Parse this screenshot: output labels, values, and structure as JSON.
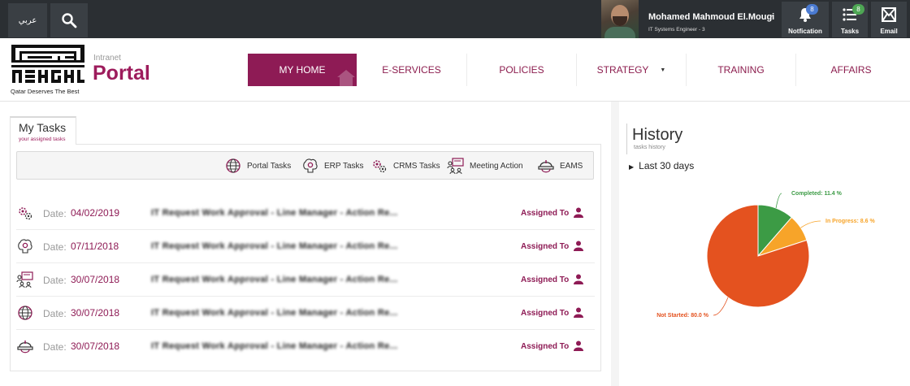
{
  "topbar": {
    "language_label": "عربي",
    "user": {
      "name": "Mohamed Mahmoud El.Mougi",
      "role": "IT Systems Engineer - 3"
    },
    "notification": {
      "label": "Notfication",
      "count": "8"
    },
    "tasks": {
      "label": "Tasks",
      "count": "8"
    },
    "email": {
      "label": "Email"
    }
  },
  "header": {
    "tagline": "Qatar Deserves The Best",
    "intranet": "Intranet",
    "portal": "Portal",
    "nav": [
      {
        "label": "MY HOME"
      },
      {
        "label": "E-SERVICES"
      },
      {
        "label": "POLICIES"
      },
      {
        "label": "STRATEGY"
      },
      {
        "label": "TRAINING"
      },
      {
        "label": "AFFAIRS"
      }
    ]
  },
  "tasks_panel": {
    "tab_title": "My Tasks",
    "tab_subtitle": "your assigned tasks",
    "filters": [
      {
        "label": "Portal Tasks",
        "icon": "globe-gear-icon"
      },
      {
        "label": "ERP Tasks",
        "icon": "brain-gear-icon"
      },
      {
        "label": "CRMS Tasks",
        "icon": "gears-icon"
      },
      {
        "label": "Meeting Action",
        "icon": "meeting-icon"
      },
      {
        "label": "EAMS",
        "icon": "helmet-icon"
      }
    ],
    "rows": [
      {
        "date_label": "Date:",
        "date": "04/02/2019",
        "title": "IT Request Work Approval - Line Manager - Action Re...",
        "assigned": "Assigned To",
        "icon": "gears-icon"
      },
      {
        "date_label": "Date:",
        "date": "07/11/2018",
        "title": "IT Request Work Approval - Line Manager - Action Re...",
        "assigned": "Assigned To",
        "icon": "brain-gear-icon"
      },
      {
        "date_label": "Date:",
        "date": "30/07/2018",
        "title": "IT Request Work Approval - Line Manager - Action Re...",
        "assigned": "Assigned To",
        "icon": "meeting-icon"
      },
      {
        "date_label": "Date:",
        "date": "30/07/2018",
        "title": "IT Request Work Approval - Line Manager - Action Re...",
        "assigned": "Assigned To",
        "icon": "globe-gear-icon"
      },
      {
        "date_label": "Date:",
        "date": "30/07/2018",
        "title": "IT Request Work Approval - Line Manager - Action Re...",
        "assigned": "Assigned To",
        "icon": "helmet-icon"
      }
    ]
  },
  "history": {
    "title": "History",
    "subtitle": "tasks history",
    "range": "Last 30 days",
    "colors": {
      "completed": "#3c9b45",
      "in_progress": "#f7a429",
      "not_started": "#e4521f"
    }
  },
  "chart_data": {
    "type": "pie",
    "categories": [
      "Completed",
      "In Progress",
      "Not Started"
    ],
    "values": [
      11.4,
      8.6,
      80.0
    ],
    "labels": [
      "Completed: 11.4 %",
      "In Progress: 8.6 %",
      "Not Started: 80.0 %"
    ],
    "colors": [
      "#3c9b45",
      "#f7a429",
      "#e4521f"
    ]
  },
  "theme": {
    "brand": "#8e1b55",
    "topbar": "#2b2f33"
  }
}
